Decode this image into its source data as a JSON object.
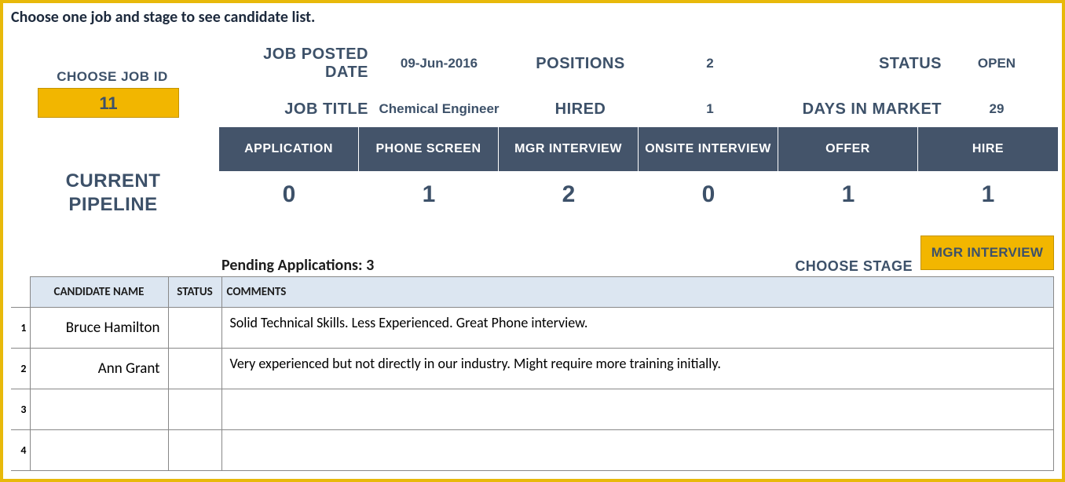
{
  "instruction": "Choose one job and stage to see candidate list.",
  "choose_job": {
    "label": "CHOOSE JOB ID",
    "value": "11"
  },
  "pipeline_label_l1": "CURRENT",
  "pipeline_label_l2": "PIPELINE",
  "meta": {
    "posted_date": {
      "label": "JOB POSTED DATE",
      "value": "09-Jun-2016"
    },
    "positions": {
      "label": "POSITIONS",
      "value": "2"
    },
    "status": {
      "label": "STATUS",
      "value": "OPEN"
    },
    "title": {
      "label": "JOB TITLE",
      "value": "Chemical Engineer"
    },
    "hired": {
      "label": "HIRED",
      "value": "1"
    },
    "days": {
      "label": "DAYS IN MARKET",
      "value": "29"
    }
  },
  "stages": [
    {
      "label": "APPLICATION",
      "count": "0"
    },
    {
      "label": "PHONE SCREEN",
      "count": "1"
    },
    {
      "label": "MGR INTERVIEW",
      "count": "2"
    },
    {
      "label": "ONSITE INTERVIEW",
      "count": "0"
    },
    {
      "label": "OFFER",
      "count": "1"
    },
    {
      "label": "HIRE",
      "count": "1"
    }
  ],
  "pending_label": "Pending Applications: 3",
  "choose_stage": {
    "label": "CHOOSE STAGE",
    "value": "MGR INTERVIEW"
  },
  "table": {
    "headers": {
      "name": "CANDIDATE NAME",
      "status": "STATUS",
      "comments": "COMMENTS"
    },
    "rows": [
      {
        "n": "1",
        "name": "Bruce Hamilton",
        "status": "",
        "comments": "Solid Technical Skills. Less Experienced. Great Phone interview."
      },
      {
        "n": "2",
        "name": "Ann Grant",
        "status": "",
        "comments": "Very experienced but not directly in our industry. Might require more training initially."
      },
      {
        "n": "3",
        "name": "",
        "status": "",
        "comments": ""
      },
      {
        "n": "4",
        "name": "",
        "status": "",
        "comments": ""
      }
    ]
  }
}
